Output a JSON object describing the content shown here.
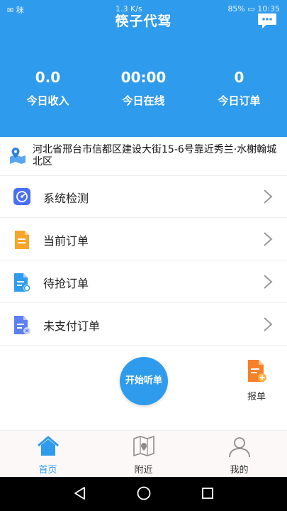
{
  "status_bar": {
    "left_text": "✉ 秣",
    "speed": "1.3 K/s",
    "battery": "85%",
    "time": "10:35"
  },
  "header": {
    "title": "筷子代驾"
  },
  "stats": [
    {
      "value": "0.0",
      "label": "今日收入"
    },
    {
      "value": "00:00",
      "label": "今日在线"
    },
    {
      "value": "0",
      "label": "今日订单"
    }
  ],
  "address": "河北省邢台市信都区建设大街15-6号靠近秀兰·水榭翰城北区",
  "menu": [
    {
      "label": "系统检测",
      "icon": "system-check-icon"
    },
    {
      "label": "当前订单",
      "icon": "current-order-icon"
    },
    {
      "label": "待抢订单",
      "icon": "pending-order-icon"
    },
    {
      "label": "未支付订单",
      "icon": "unpaid-order-icon"
    }
  ],
  "start_button": "开始听单",
  "report_label": "报单",
  "tabs": [
    {
      "label": "首页",
      "icon": "home-icon",
      "active": true
    },
    {
      "label": "附近",
      "icon": "map-icon",
      "active": false
    },
    {
      "label": "我的",
      "icon": "user-icon",
      "active": false
    }
  ],
  "colors": {
    "primary": "#2f9bec",
    "tab_bg": "#fcf8f7"
  }
}
